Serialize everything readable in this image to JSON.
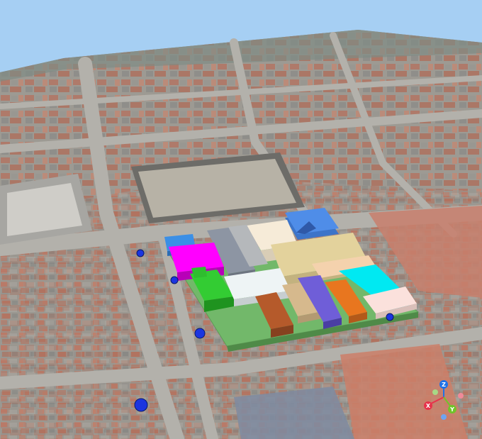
{
  "scene": {
    "sky_color": "#a6cff3",
    "ground_base_color": "#8f8f8b",
    "site_color": "#72b86a"
  },
  "building_colors": {
    "blue_left": "#3b8fe6",
    "magenta": "#ff00ff",
    "gray_dark": "#8d95a3",
    "gray_light": "#b5b8bb",
    "cream": "#f6ebd8",
    "blue_right": "#4f8de8",
    "khaki": "#e3d29c",
    "peach": "#f4d2ad",
    "green": "#33cc33",
    "white_gray": "#eef4f5",
    "brown": "#b55a2b",
    "tan": "#d6b98d",
    "purple": "#6f5ed8",
    "orange": "#e8761f",
    "cyan": "#00e9f2",
    "pink_light": "#fbe1dc"
  },
  "navigation": {
    "marker_color": "#1b35e0",
    "gizmo": {
      "x_label": "X",
      "y_label": "Y",
      "z_label": "Z",
      "x_color": "#e7324b",
      "y_color": "#71c32b",
      "z_color": "#1e72e8"
    }
  }
}
